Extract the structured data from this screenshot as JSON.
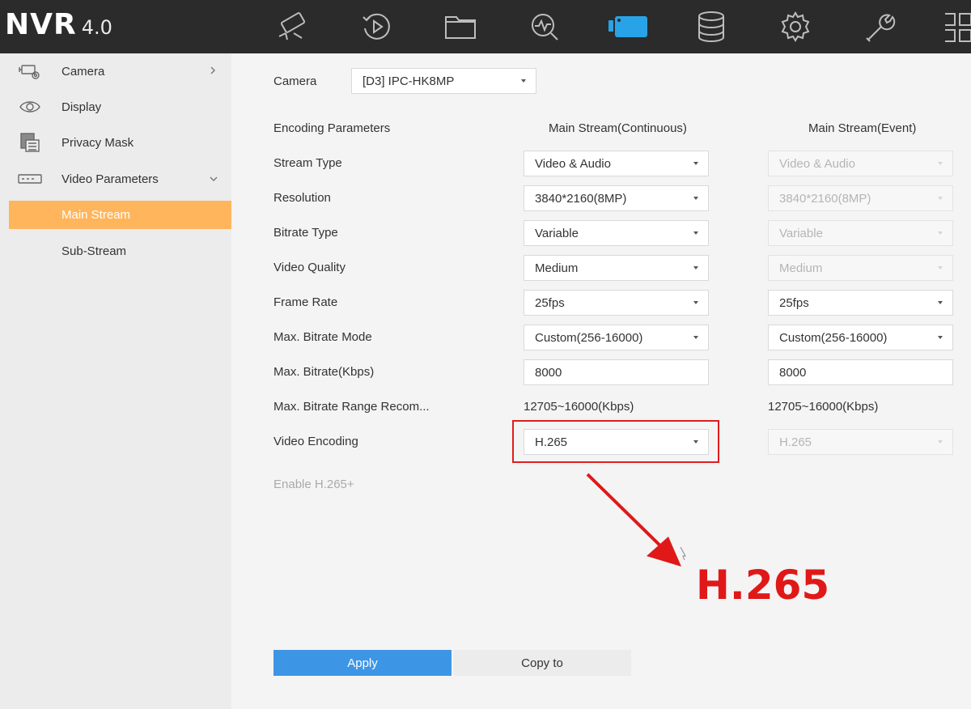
{
  "app": {
    "name": "NVR",
    "version": "4.0"
  },
  "topnav": [
    {
      "name": "live-view-icon"
    },
    {
      "name": "playback-icon"
    },
    {
      "name": "file-management-icon"
    },
    {
      "name": "smart-analysis-icon"
    },
    {
      "name": "camera-icon",
      "active": true
    },
    {
      "name": "storage-icon"
    },
    {
      "name": "system-settings-icon"
    },
    {
      "name": "maintenance-icon"
    },
    {
      "name": "more-icon"
    }
  ],
  "sidebar": {
    "items": [
      {
        "label": "Camera"
      },
      {
        "label": "Display"
      },
      {
        "label": "Privacy Mask"
      },
      {
        "label": "Video Parameters"
      },
      {
        "label": "Main Stream"
      },
      {
        "label": "Sub-Stream"
      }
    ]
  },
  "main": {
    "camera_label": "Camera",
    "camera_value": "[D3] IPC-HK8MP",
    "header": {
      "params": "Encoding Parameters",
      "continuous": "Main Stream(Continuous)",
      "event": "Main Stream(Event)"
    },
    "rows": [
      {
        "label": "Stream Type",
        "continuous": "Video & Audio",
        "event": "Video & Audio"
      },
      {
        "label": "Resolution",
        "continuous": "3840*2160(8MP)",
        "event": "3840*2160(8MP)"
      },
      {
        "label": "Bitrate Type",
        "continuous": "Variable",
        "event": "Variable"
      },
      {
        "label": "Video Quality",
        "continuous": "Medium",
        "event": "Medium"
      },
      {
        "label": "Frame Rate",
        "continuous": "25fps",
        "event": "25fps"
      },
      {
        "label": "Max. Bitrate Mode",
        "continuous": "Custom(256-16000)",
        "event": "Custom(256-16000)"
      },
      {
        "label": "Max. Bitrate(Kbps)",
        "continuous": "8000",
        "event": "8000"
      },
      {
        "label": "Max. Bitrate Range Recom...",
        "continuous": "12705~16000(Kbps)",
        "event": "12705~16000(Kbps)"
      },
      {
        "label": "Video Encoding",
        "continuous": "H.265",
        "event": "H.265"
      }
    ],
    "enable_h265plus": "Enable H.265+",
    "apply": "Apply",
    "copy_to": "Copy to"
  },
  "annotation": {
    "text": "H.265",
    "color": "#e01818"
  }
}
